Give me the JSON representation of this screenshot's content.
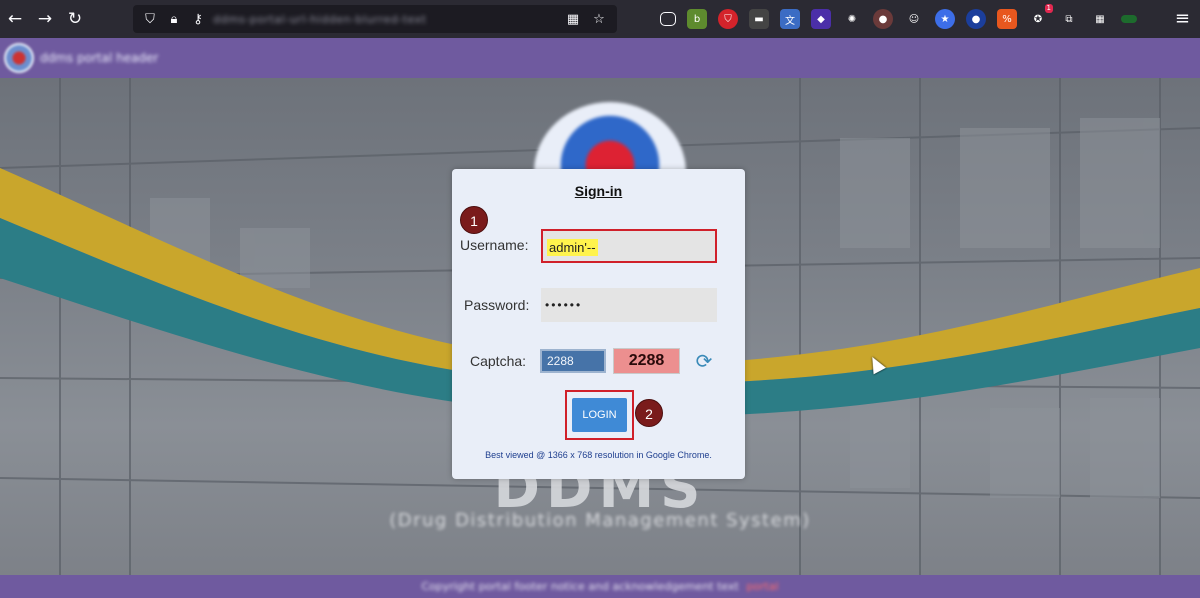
{
  "browser": {
    "back_icon": "arrow-left-icon",
    "forward_icon": "arrow-right-icon",
    "reload_icon": "reload-icon",
    "url_blurred": "ddms-portal-url-hidden-blurred-text"
  },
  "site": {
    "header_title_blurred": "ddms portal header",
    "bg_title": "DDMS",
    "bg_subtitle_blurred": "(Drug Distribution Management System)",
    "footer_blurred": "Copyright portal footer notice and acknowledgement text",
    "footer_link_blurred": "portal"
  },
  "login": {
    "title": "Sign-in",
    "username_label": "Username:",
    "username_value": "admin'--",
    "password_label": "Password:",
    "password_value": "••••••",
    "captcha_label": "Captcha:",
    "captcha_input_value": "2288",
    "captcha_image_text": "2288",
    "login_label": "LOGIN",
    "note": "Best viewed @ 1366 x 768 resolution in Google Chrome."
  },
  "steps": {
    "one": "1",
    "two": "2"
  },
  "colors": {
    "header_bg": "#6f5a9f",
    "highlight": "#d0202a",
    "login_button": "#3f8ad6"
  }
}
